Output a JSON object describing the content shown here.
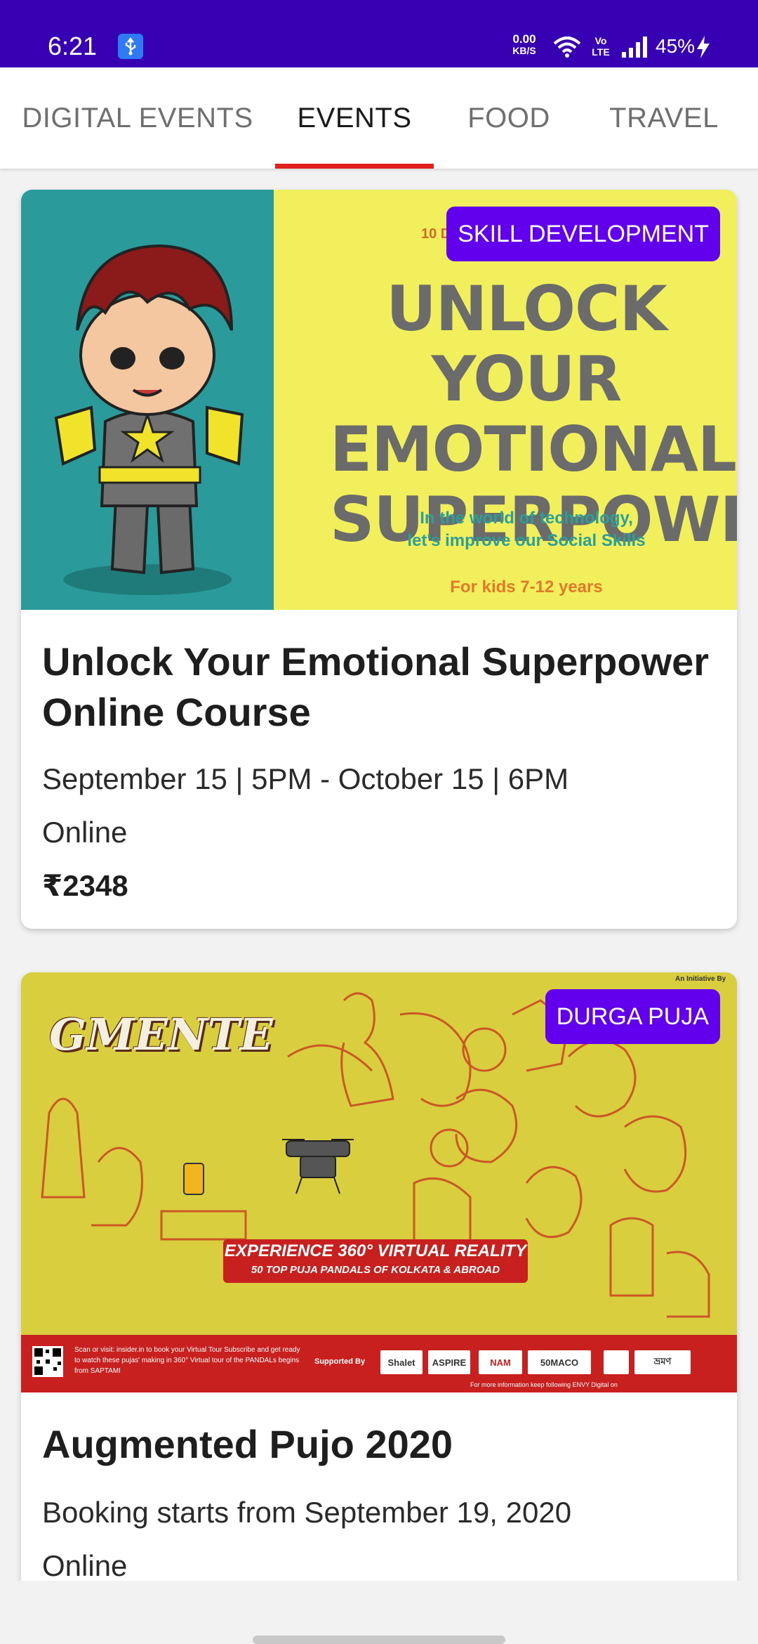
{
  "status_bar": {
    "time": "6:21",
    "net_speed_value": "0.00",
    "net_speed_unit": "KB/S",
    "volte_line1": "Vo",
    "volte_line2": "LTE",
    "battery": "45%",
    "bar_color": "#3700b3"
  },
  "tabs": [
    {
      "label": "DIGITAL EVENTS",
      "active": false
    },
    {
      "label": "EVENTS",
      "active": true
    },
    {
      "label": "FOOD",
      "active": false
    },
    {
      "label": "TRAVEL",
      "active": false
    }
  ],
  "colors": {
    "accent": "#6200ee",
    "tab_indicator": "#e0201c"
  },
  "events": [
    {
      "badge": "SKILL DEVELOPMENT",
      "title": "Unlock Your Emotional Superpower Online Course",
      "dates": "September 15 | 5PM - October 15 | 6PM",
      "location": "Online",
      "price": "₹2348",
      "banner": {
        "topline": "10 D",
        "headline": "UNLOCK YOUR EMOTIONAL SUPERPOWER",
        "subtitle_line1": "In the world of technology,",
        "subtitle_line2": "let's improve our Social Skills",
        "audience": "For kids 7-12 years"
      }
    },
    {
      "badge": "DURGA PUJA",
      "title": "Augmented Pujo 2020",
      "dates": "Booking starts from September 19, 2020",
      "location": "Online",
      "banner": {
        "logo_text": "GMENTE",
        "vr_headline": "EXPERIENCE 360° VIRTUAL REALITY",
        "vr_sub": "50 TOP PUJA  PANDALS OF KOLKATA & ABROAD",
        "footer_text": "Scan or visit: insider.in to book your Virtual Tour Subscribe and get ready to watch these pujas' making in 360° Virtual tour of the PANDALs begins from SAPTAMI",
        "supported_by": "Supported By",
        "sponsors": [
          "Shalet",
          "ASPIRE",
          "NAM",
          "50MACO",
          "",
          "ভ্রমণ"
        ],
        "more_info": "For more information keep following ENVY Digital on",
        "initiative": "An Initiative By"
      }
    }
  ]
}
